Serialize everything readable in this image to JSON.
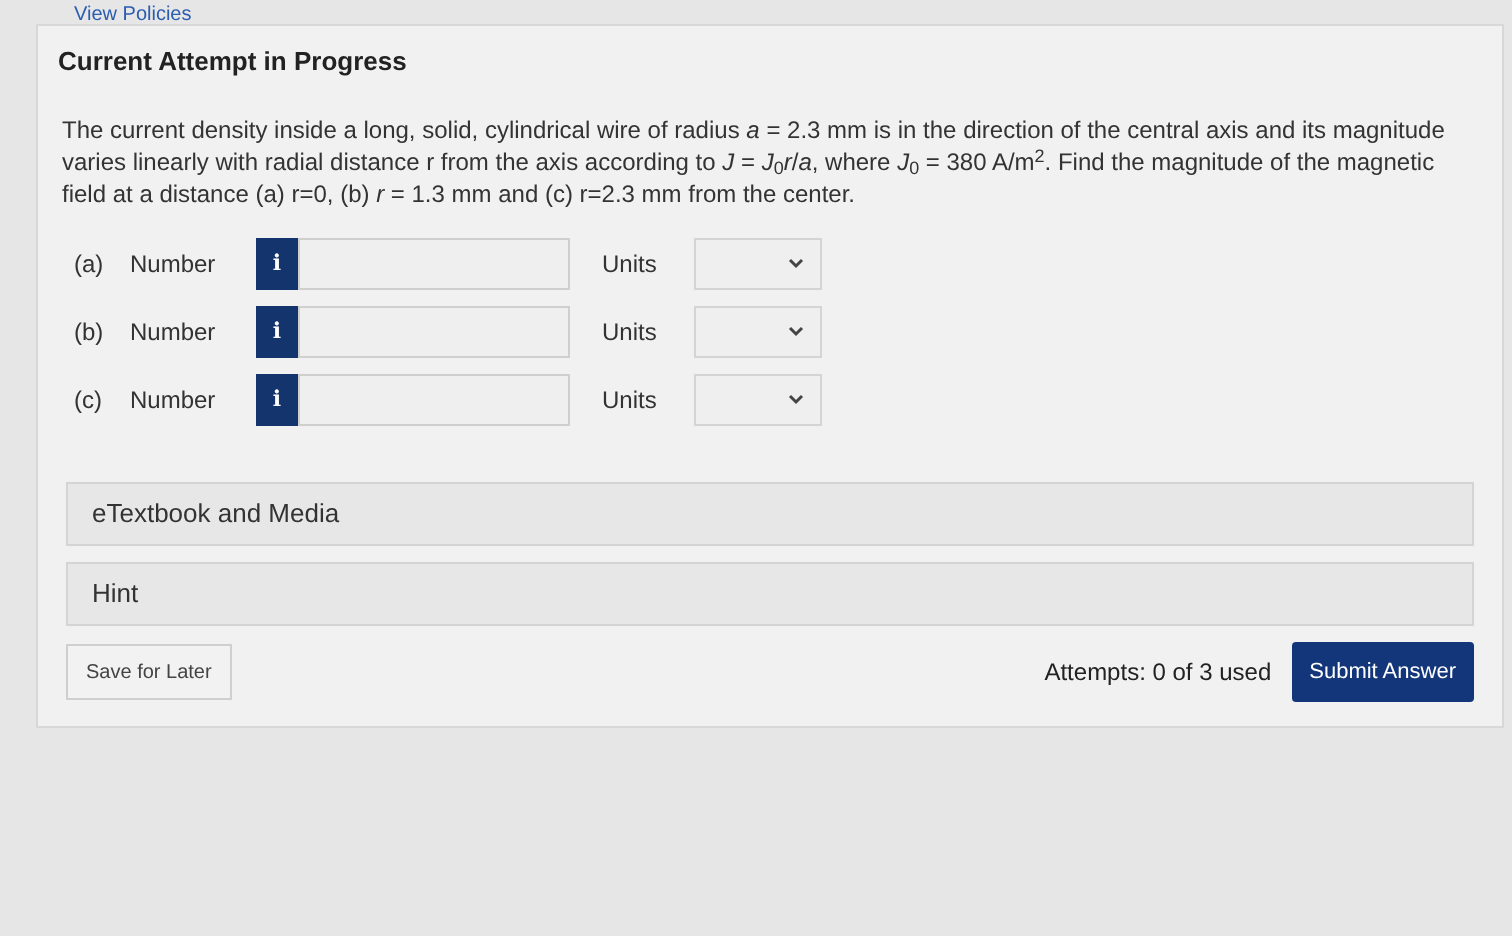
{
  "top_link": "View Policies",
  "heading": "Current Attempt in Progress",
  "question": "The current density inside a long, solid, cylindrical wire of radius *a* = 2.3 mm is in the direction of the central axis and its magnitude varies linearly with radial distance r from the axis according to *J* = *J*$_{0}$*r*/*a*, where *J*$_{0}$ = 380 A/m$^{2}$. Find the magnitude of the magnetic field at a distance (a) r=0, (b) *r* = 1.3 mm and (c) r=2.3 mm from the center.",
  "answers": [
    {
      "part": "(a)",
      "label": "Number",
      "info": "i",
      "units_label": "Units"
    },
    {
      "part": "(b)",
      "label": "Number",
      "info": "i",
      "units_label": "Units"
    },
    {
      "part": "(c)",
      "label": "Number",
      "info": "i",
      "units_label": "Units"
    }
  ],
  "sections": [
    "eTextbook and Media",
    "Hint"
  ],
  "save_button": "Save for Later",
  "attempts": "Attempts: 0 of 3 used",
  "submit_button": "Submit Answer"
}
